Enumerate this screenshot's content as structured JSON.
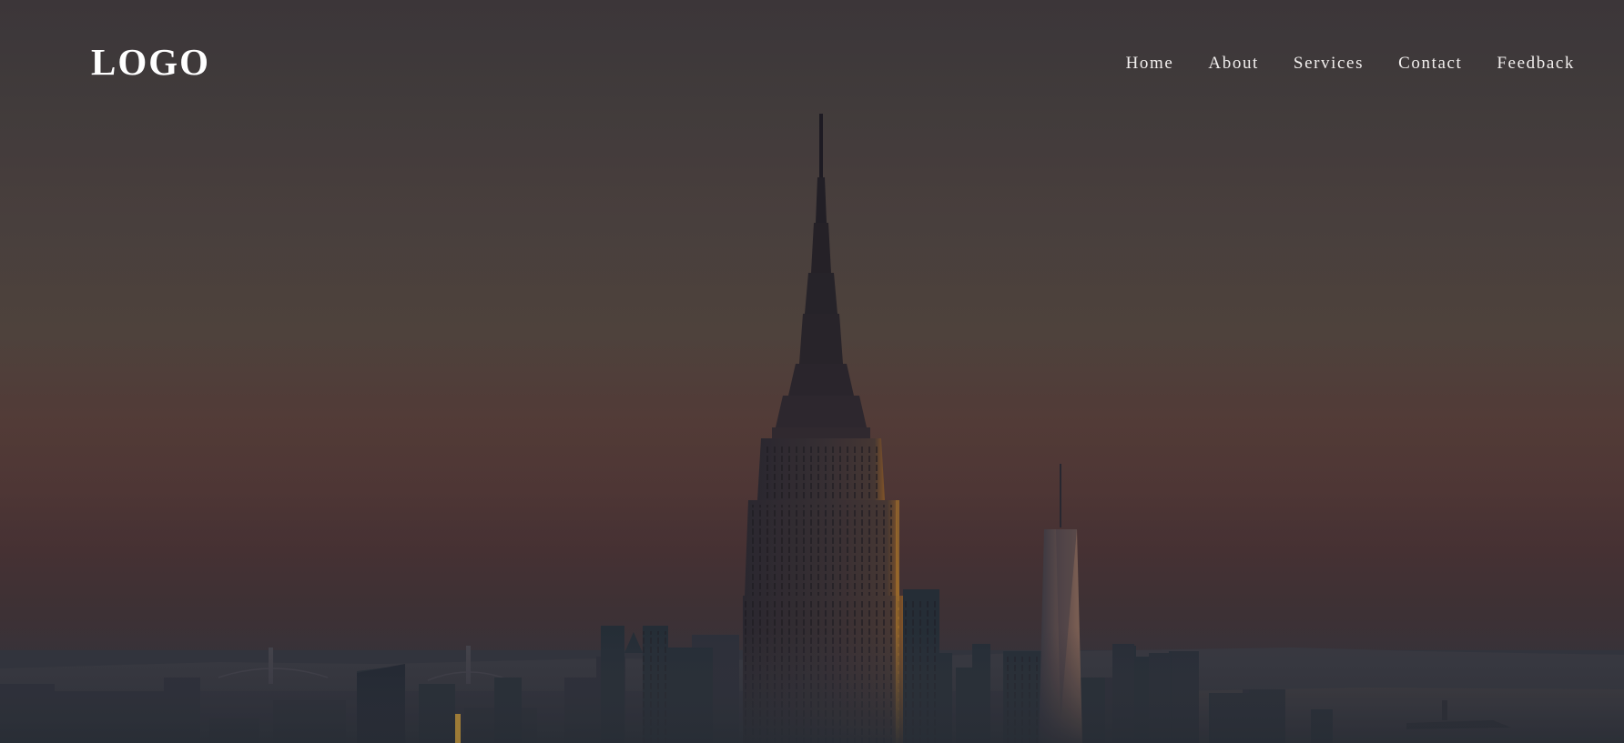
{
  "header": {
    "logo_text": "LOGO",
    "nav_items": [
      {
        "label": "Home"
      },
      {
        "label": "About"
      },
      {
        "label": "Services"
      },
      {
        "label": "Contact"
      },
      {
        "label": "Feedback"
      }
    ]
  },
  "hero": {
    "background_image": "city-skyline-dusk",
    "colors": {
      "sky_top": "#3f3a3c",
      "sky_mid": "#573f3a",
      "sky_bottom": "#34363f",
      "nav_text": "#f2efee"
    }
  }
}
